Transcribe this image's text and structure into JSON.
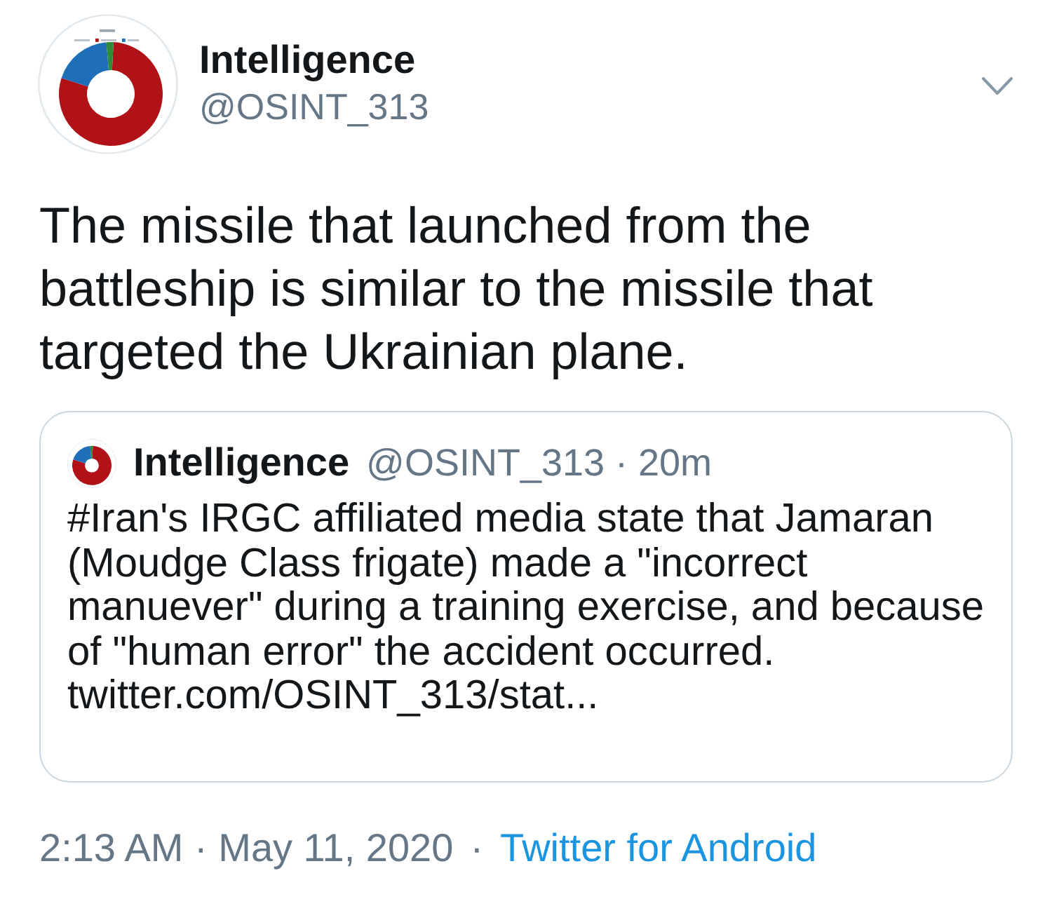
{
  "author": {
    "name": "Intelligence",
    "handle": "@OSINT_313"
  },
  "tweet": {
    "text": "The missile that launched from the battleship is similar to the missile that targeted the Ukrainian plane."
  },
  "quoted_tweet": {
    "name": "Intelligence",
    "meta": "@OSINT_313 · 20m",
    "text": "#Iran's IRGC affiliated media state that Jamaran (Moudge Class frigate) made a \"incorrect manuever\" during a training exercise, and because of \"human error\" the accident occurred.",
    "link": "twitter.com/OSINT_313/stat..."
  },
  "footer": {
    "timestamp": "2:13 AM · May 11, 2020",
    "separator": "·",
    "source": "Twitter for Android"
  }
}
